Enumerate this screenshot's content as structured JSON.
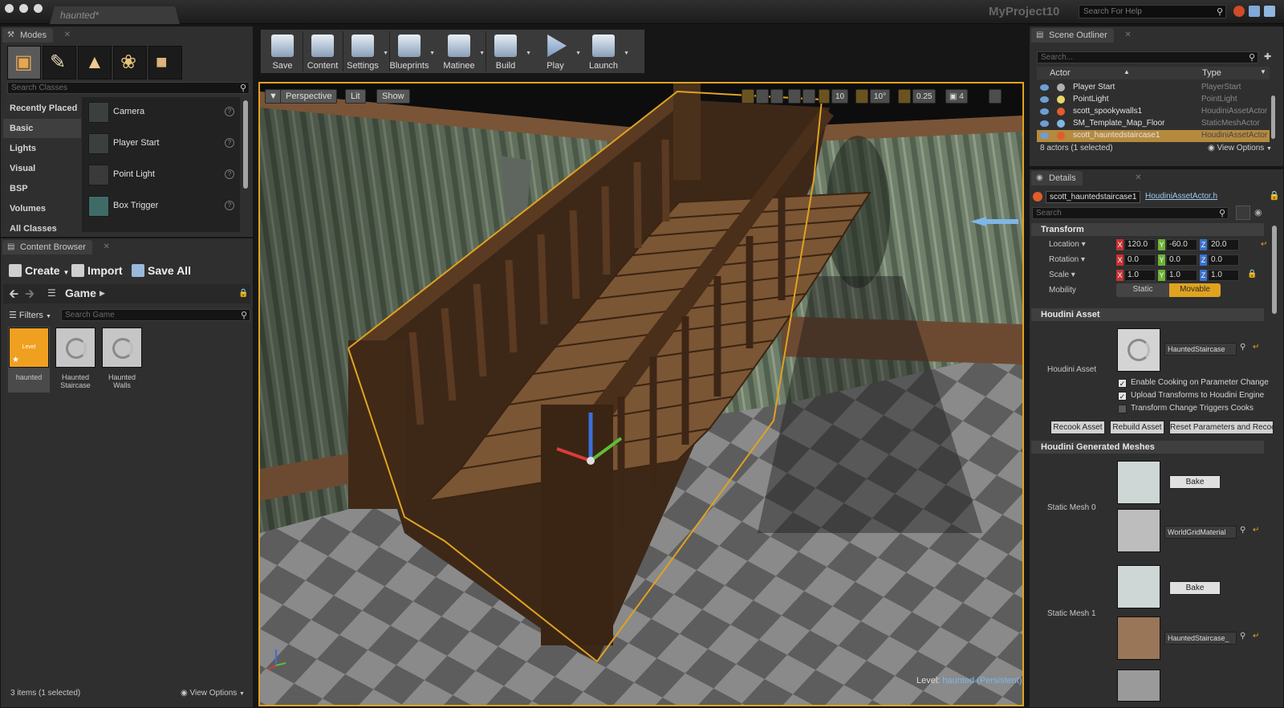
{
  "titlebar": {
    "doc_tab": "haunted*",
    "project": "MyProject10",
    "help_placeholder": "Search For Help"
  },
  "modes": {
    "tab": "Modes",
    "mode_icons": [
      "place-mode-icon",
      "paint-mode-icon",
      "landscape-mode-icon",
      "foliage-mode-icon",
      "geometry-mode-icon"
    ],
    "search_placeholder": "Search Classes",
    "categories": [
      "Recently Placed",
      "Basic",
      "Lights",
      "Visual",
      "BSP",
      "Volumes",
      "All Classes"
    ],
    "selected_category": "Basic",
    "classes": [
      {
        "label": "Camera",
        "icon": "camera-icon"
      },
      {
        "label": "Player Start",
        "icon": "player-start-icon"
      },
      {
        "label": "Point Light",
        "icon": "point-light-icon"
      },
      {
        "label": "Box Trigger",
        "icon": "box-trigger-icon"
      }
    ]
  },
  "content_browser": {
    "tab": "Content Browser",
    "create": "Create",
    "import": "Import",
    "save_all": "Save All",
    "path": "Game",
    "filters": "Filters",
    "search_placeholder": "Search Game",
    "assets": [
      {
        "thumb_label": "Level",
        "label": "haunted"
      },
      {
        "label": "Haunted Staircase"
      },
      {
        "label": "Haunted Walls"
      }
    ],
    "status": "3 items (1 selected)",
    "view_options": "View Options"
  },
  "toolbar": {
    "items": [
      {
        "label": "Save",
        "icon": "save-icon"
      },
      {
        "label": "Content",
        "icon": "content-icon"
      },
      {
        "label": "Settings",
        "icon": "settings-icon"
      },
      {
        "label": "Blueprints",
        "icon": "blueprints-icon"
      },
      {
        "label": "Matinee",
        "icon": "matinee-icon"
      },
      {
        "label": "Build",
        "icon": "build-icon"
      },
      {
        "label": "Play",
        "icon": "play-icon"
      },
      {
        "label": "Launch",
        "icon": "launch-icon"
      }
    ]
  },
  "viewport": {
    "perspective": "Perspective",
    "lit": "Lit",
    "show": "Show",
    "grid_snap": "10",
    "rot_snap": "10°",
    "scale_snap": "0.25",
    "camera_speed": "4",
    "level_label": "Level:",
    "level_name": "haunted (Persistent)"
  },
  "outliner": {
    "tab": "Scene Outliner",
    "search_placeholder": "Search...",
    "col_actor": "Actor",
    "col_type": "Type",
    "rows": [
      {
        "name": "Player Start",
        "type": "PlayerStart",
        "icon_color": "#b0b0b0"
      },
      {
        "name": "PointLight",
        "type": "PointLight",
        "icon_color": "#e8d66a"
      },
      {
        "name": "scott_spookywalls1",
        "type": "HoudiniAssetActor",
        "icon_color": "#e05d2a"
      },
      {
        "name": "SM_Template_Map_Floor",
        "type": "StaticMeshActor",
        "icon_color": "#7fb6e6"
      },
      {
        "name": "scott_hauntedstaircase1",
        "type": "HoudiniAssetActor",
        "icon_color": "#e05d2a"
      }
    ],
    "selected_row": 4,
    "status": "8 actors (1 selected)",
    "view_options": "View Options"
  },
  "details": {
    "tab": "Details",
    "actor_name": "scott_hauntedstaircase1",
    "actor_class": "HoudiniAssetActor.h",
    "search_placeholder": "Search",
    "transform_title": "Transform",
    "location": {
      "label": "Location",
      "x": "120.0",
      "y": "-60.0",
      "z": "20.0"
    },
    "rotation": {
      "label": "Rotation",
      "x": "0.0",
      "y": "0.0",
      "z": "0.0"
    },
    "scale": {
      "label": "Scale",
      "x": "1.0",
      "y": "1.0",
      "z": "1.0"
    },
    "mobility": {
      "label": "Mobility",
      "static": "Static",
      "movable": "Movable",
      "selected": "Movable"
    },
    "houdini_title": "Houdini Asset",
    "houdini_asset_label": "Houdini Asset",
    "houdini_asset_value": "HauntedStaircase",
    "checks": [
      {
        "label": "Enable Cooking on Parameter Change",
        "checked": true
      },
      {
        "label": "Upload Transforms to Houdini Engine",
        "checked": true
      },
      {
        "label": "Transform Change Triggers Cooks",
        "checked": false
      }
    ],
    "recook": "Recook Asset",
    "rebuild": "Rebuild Asset",
    "reset": "Reset Parameters and Recook",
    "generated_title": "Houdini Generated Meshes",
    "mesh0_label": "Static Mesh 0",
    "mesh1_label": "Static Mesh 1",
    "bake": "Bake",
    "mesh0_material": "WorldGridMaterial",
    "mesh1_material": "HauntedStaircase_"
  },
  "colors": {
    "accent": "#e0a320",
    "selection": "#b58a3f",
    "panel": "#2f2f2f",
    "link": "#9fcaf0"
  }
}
